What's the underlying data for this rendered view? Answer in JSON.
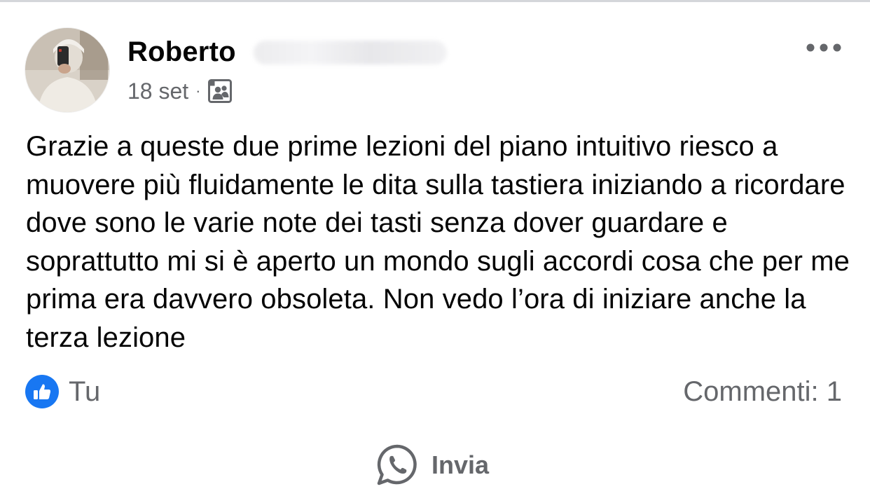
{
  "post": {
    "author_name": "Roberto",
    "date": "18 set",
    "separator": "·",
    "privacy_icon": "group-audience-icon",
    "more_icon": "more-options-icon",
    "body": "Grazie a queste due prime lezioni del piano intuitivo riesco a muovere più fluidamente le dita sulla tastiera iniziando a ricordare dove sono le varie note dei tasti senza dover guardare e soprattutto mi si è aperto un mondo sugli accordi cosa che per me prima era davvero obsoleta. Non vedo l’ora di iniziare anche la terza lezione"
  },
  "reactions": {
    "icon": "like-icon",
    "label": "Tu",
    "accent": "#1877f2"
  },
  "comments": {
    "label": "Commenti: 1"
  },
  "share": {
    "icon": "whatsapp-icon",
    "label": "Invia"
  },
  "colors": {
    "text_primary": "#050505",
    "text_secondary": "#65676b",
    "like_blue": "#1877f2"
  }
}
